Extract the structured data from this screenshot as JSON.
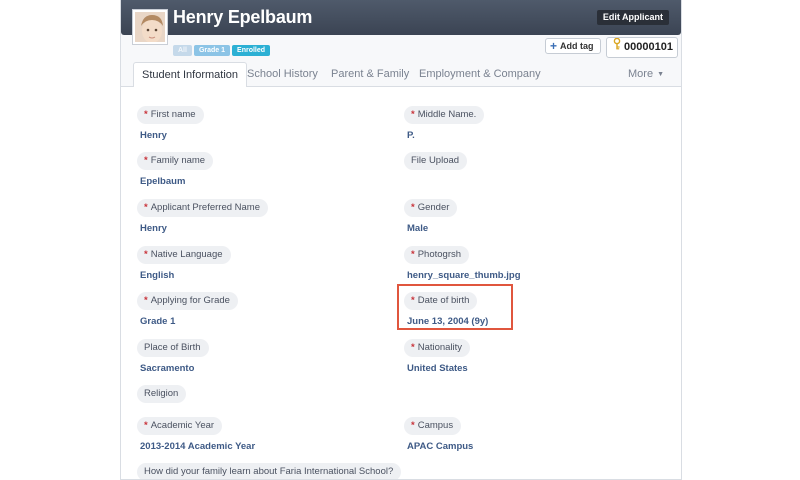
{
  "applicant": {
    "name": "Henry Epelbaum",
    "edit_label": "Edit Applicant",
    "badges": [
      "All",
      "Grade 1",
      "Enrolled"
    ],
    "add_tag_label": "Add tag",
    "id": "00000101"
  },
  "tabs": [
    {
      "label": "Student Information",
      "active": true
    },
    {
      "label": "School History",
      "active": false
    },
    {
      "label": "Parent & Family",
      "active": false
    },
    {
      "label": "Employment & Company",
      "active": false
    },
    {
      "label": "More",
      "active": false
    }
  ],
  "fields": {
    "first_name": {
      "label": "First name",
      "value": "Henry",
      "required": true
    },
    "middle_name": {
      "label": "Middle Name.",
      "value": "P.",
      "required": true
    },
    "family_name": {
      "label": "Family name",
      "value": "Epelbaum",
      "required": true
    },
    "file_upload": {
      "label": "File Upload",
      "value": "",
      "required": false
    },
    "preferred_name": {
      "label": "Applicant Preferred Name",
      "value": "Henry",
      "required": true
    },
    "gender": {
      "label": "Gender",
      "value": "Male",
      "required": true
    },
    "native_language": {
      "label": "Native Language",
      "value": "English",
      "required": true
    },
    "photograph": {
      "label": "Photogrsh",
      "value": "henry_square_thumb.jpg",
      "required": true
    },
    "applying_grade": {
      "label": "Applying for Grade",
      "value": "Grade 1",
      "required": true
    },
    "date_of_birth": {
      "label": "Date of birth",
      "value": "June 13, 2004 (9y)",
      "required": true
    },
    "place_of_birth": {
      "label": "Place of Birth",
      "value": "Sacramento",
      "required": false
    },
    "nationality": {
      "label": "Nationality",
      "value": "United States",
      "required": true
    },
    "religion": {
      "label": "Religion",
      "value": "",
      "required": false
    },
    "academic_year": {
      "label": "Academic Year",
      "value": "2013-2014 Academic Year",
      "required": true
    },
    "campus": {
      "label": "Campus",
      "value": "APAC Campus",
      "required": true
    },
    "how_learned": {
      "label": "How did your family learn about Faria International School?",
      "value": "",
      "required": false
    }
  },
  "colors": {
    "required_marker": "#c8323a",
    "value_text": "#3e5a86",
    "highlight_box": "#e0563e",
    "status_badge": "#2cb0d4"
  },
  "required_marker": "*"
}
